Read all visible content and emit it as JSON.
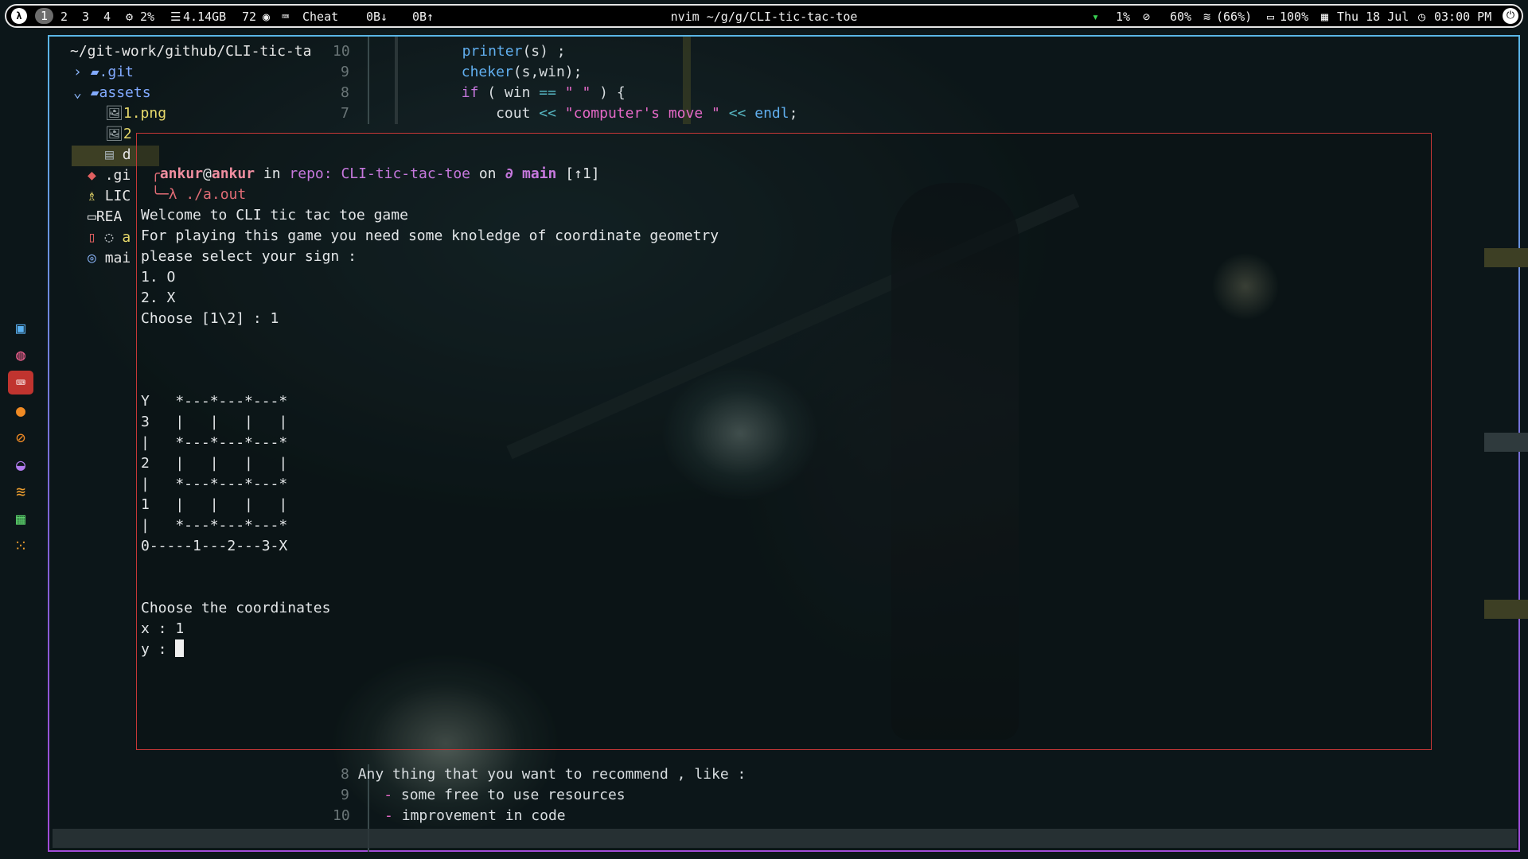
{
  "topbar": {
    "logo": "λ",
    "workspaces": [
      "1",
      "2",
      "3",
      "4"
    ],
    "cpu": "2%",
    "memory": "4.14GB",
    "temp": "72",
    "cheat": "Cheat",
    "net_down": "0B↓",
    "net_up": "0B↑",
    "window_title": "nvim ~/g/g/CLI-tic-tac-toe",
    "net_load": "1%",
    "brightness": "60%",
    "wifi": "(66%)",
    "battery": "100%",
    "date": "Thu 18 Jul",
    "time": "03:00 PM",
    "power": "⏻"
  },
  "dock": {
    "items": [
      "files-icon",
      "browser-icon",
      "terminal-icon",
      "firefox-icon",
      "compass-icon",
      "gamepad-icon",
      "layers-icon",
      "monitor-icon",
      "apps-grid-icon"
    ]
  },
  "tree": {
    "root": "~/git-work/github/CLI-tic-ta",
    "items": [
      {
        "arrow": "›",
        "icon": "▰",
        "name": ".git"
      },
      {
        "arrow": "⌄",
        "icon": "▰",
        "name": "assets"
      },
      {
        "icon": "🖼",
        "name": "1.png"
      },
      {
        "icon": "🖼",
        "name": "2"
      },
      {
        "icon": "▤",
        "name": "d"
      },
      {
        "icon": "◆",
        "name": ".gi"
      },
      {
        "icon": "♗",
        "name": "LIC"
      },
      {
        "icon": "▭",
        "name": "REA"
      },
      {
        "icon": "▯",
        "name": "a"
      },
      {
        "icon": "◎",
        "name": "mai"
      }
    ]
  },
  "editor_top": {
    "lines": [
      {
        "num": "10",
        "code_fn": "printer",
        "code_rest": "(s) ;"
      },
      {
        "num": "9",
        "code_fn": "cheker",
        "code_rest": "(s,win);"
      },
      {
        "num": "8",
        "kw": "if",
        "rest1": " ( win ",
        "op": "==",
        "str": " \" \" ",
        "rest2": ") {"
      },
      {
        "num": "7",
        "pre": "cout ",
        "op1": "<<",
        "str": " \"computer's move \" ",
        "op2": "<<",
        "fn": " endl",
        "post": ";"
      }
    ]
  },
  "terminal": {
    "prompt_user": "ankur",
    "prompt_at": "@",
    "prompt_host": "ankur",
    "prompt_in": " in ",
    "prompt_repo": "repo: CLI-tic-tac-toe",
    "prompt_on": " on ",
    "prompt_branch": "∂ main",
    "prompt_status": " [↑1]",
    "command": "λ ./a.out",
    "output": [
      "Welcome to CLI tic tac toe game",
      "For playing this game you need some knoledge of coordinate geometry",
      "please select your sign :",
      "1. O",
      "2. X",
      "Choose [1\\2] : 1",
      "",
      "",
      "",
      "Y   *---*---*---*",
      "3   |   |   |   |",
      "|   *---*---*---*",
      "2   |   |   |   |",
      "|   *---*---*---*",
      "1   |   |   |   |",
      "|   *---*---*---*",
      "0-----1---2---3-X",
      "",
      "",
      "Choose the coordinates",
      "x : 1",
      "y : "
    ]
  },
  "editor_bottom": {
    "lines": [
      {
        "num": "8",
        "text": "Any thing that you want to recommend , like :"
      },
      {
        "num": "9",
        "bullet": "-",
        "text": " some free to use resources"
      },
      {
        "num": "10",
        "bullet": "-",
        "text": " improvement in code"
      }
    ]
  }
}
